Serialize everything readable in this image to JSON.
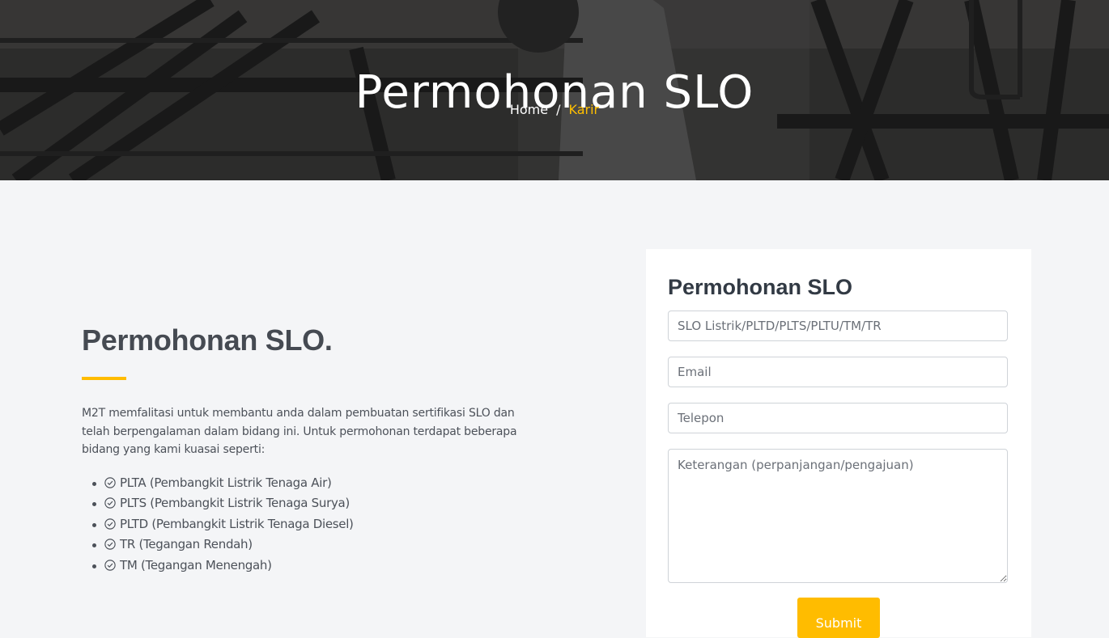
{
  "hero": {
    "title": "Permohonan SLO",
    "breadcrumb": {
      "home": "Home",
      "separator": "/",
      "current": "Karir"
    }
  },
  "content": {
    "title": "Permohonan SLO.",
    "intro": "M2T memfalitasi untuk membantu anda dalam pembuatan sertifikasi SLO dan telah berpengalaman dalam bidang ini. Untuk permohonan terdapat beberapa bidang yang kami kuasai seperti:",
    "items": [
      "PLTA (Pembangkit Listrik Tenaga Air)",
      "PLTS (Pembangkit Listrik Tenaga Surya)",
      "PLTD (Pembangkit Listrik Tenaga Diesel)",
      "TR (Tegangan Rendah)",
      "TM (Tegangan Menengah)"
    ]
  },
  "form": {
    "title": "Permohonan SLO",
    "type_placeholder": "SLO Listrik/PLTD/PLTS/PLTU/TM/TR",
    "email_placeholder": "Email",
    "phone_placeholder": "Telepon",
    "notes_placeholder": "Keterangan (perpanjangan/pengajuan)",
    "submit_label": "Submit"
  },
  "colors": {
    "accent": "#ffbc00",
    "heading": "#323a44"
  }
}
